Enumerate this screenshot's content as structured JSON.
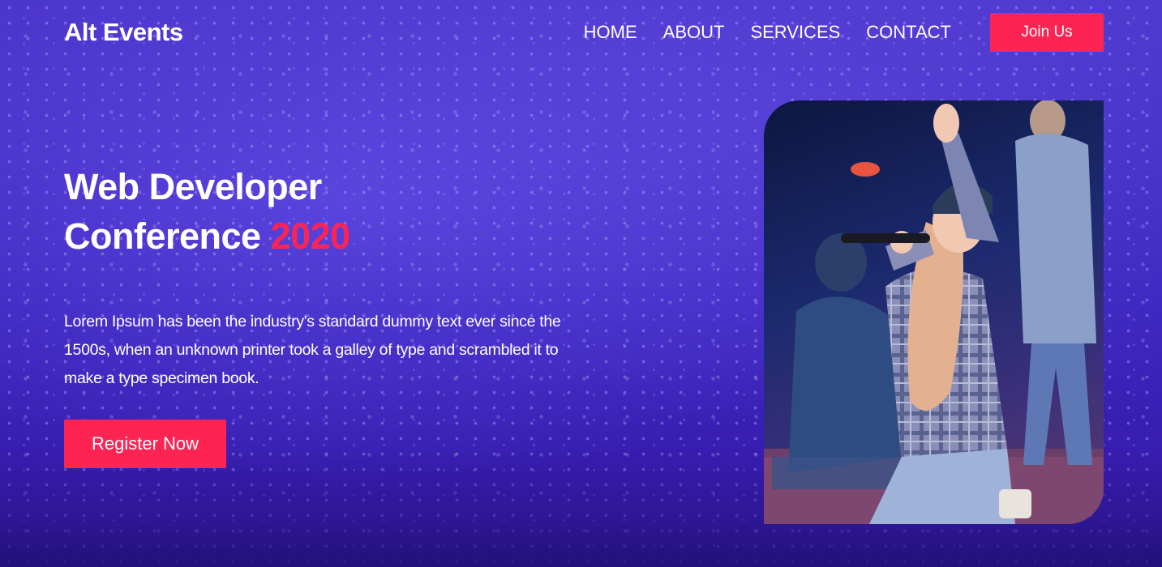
{
  "header": {
    "logo": "Alt Events",
    "nav": [
      {
        "label": "HOME"
      },
      {
        "label": "ABOUT"
      },
      {
        "label": "SERVICES"
      },
      {
        "label": "CONTACT"
      }
    ],
    "join_label": "Join Us"
  },
  "hero": {
    "title_line1": "Web Developer",
    "title_line2_prefix": "Conference ",
    "title_year": "2020",
    "description": "Lorem Ipsum has been the industry's standard dummy text ever since the 1500s, when an unknown printer took a galley of type and scrambled it to make a type specimen book.",
    "register_label": "Register Now"
  },
  "colors": {
    "accent": "#fd2454",
    "background": "#3b24bd"
  }
}
